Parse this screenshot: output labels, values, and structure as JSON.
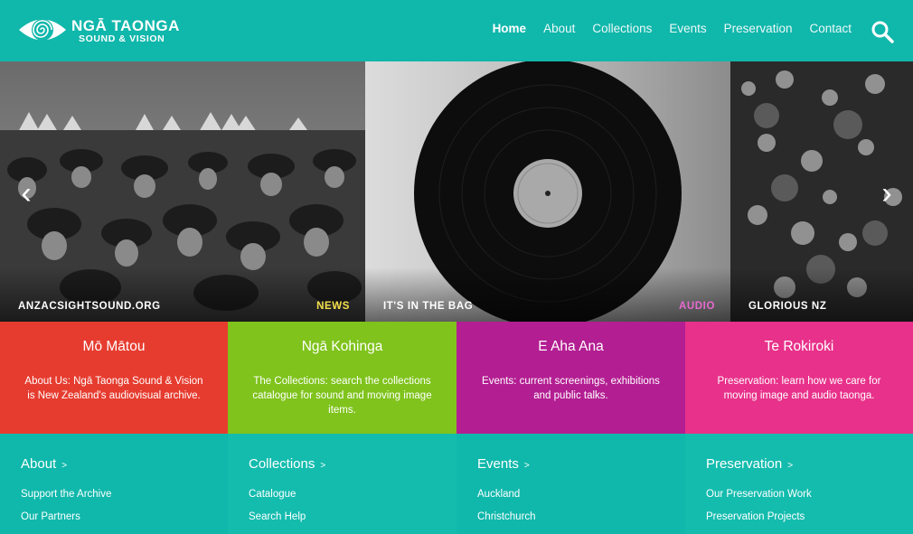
{
  "brand": {
    "title": "NGĀ TAONGA",
    "subtitle": "SOUND & VISION"
  },
  "nav": {
    "items": [
      {
        "label": "Home"
      },
      {
        "label": "About"
      },
      {
        "label": "Collections"
      },
      {
        "label": "Events"
      },
      {
        "label": "Preservation"
      },
      {
        "label": "Contact"
      }
    ],
    "active": "Home",
    "search_icon": "search-icon"
  },
  "slider": {
    "prev_icon": "chevron-left-icon",
    "next_icon": "chevron-right-icon",
    "slides": [
      {
        "caption": "ANZACSIGHTSOUND.ORG",
        "tag": "NEWS",
        "tag_color": "#f5e04b"
      },
      {
        "caption": "IT'S IN THE BAG",
        "tag": "AUDIO",
        "tag_color": "#e66ad1"
      },
      {
        "caption": "GLORIOUS NZ",
        "tag": ""
      }
    ]
  },
  "tiles": [
    {
      "title": "Mō Mātou",
      "text": "About Us: Ngā Taonga Sound & Vision is New Zealand's audiovisual archive.",
      "color": "#e63c2f"
    },
    {
      "title": "Ngā Kohinga",
      "text": "The Collections: search the collections catalogue for sound and moving image items.",
      "color": "#7fc31c"
    },
    {
      "title": "E Aha Ana",
      "text": "Events: current screenings, exhibitions and public talks.",
      "color": "#b31e92"
    },
    {
      "title": "Te Rokiroki",
      "text": "Preservation: learn how we care for moving image and audio taonga.",
      "color": "#e8318a"
    }
  ],
  "footer": {
    "columns": [
      {
        "heading": "About",
        "arrow": ">",
        "links": [
          "Support the Archive",
          "Our Partners"
        ]
      },
      {
        "heading": "Collections",
        "arrow": ">",
        "links": [
          "Catalogue",
          "Search Help"
        ]
      },
      {
        "heading": "Events",
        "arrow": ">",
        "links": [
          "Auckland",
          "Christchurch"
        ]
      },
      {
        "heading": "Preservation",
        "arrow": ">",
        "links": [
          "Our Preservation Work",
          "Preservation Projects"
        ]
      }
    ]
  }
}
